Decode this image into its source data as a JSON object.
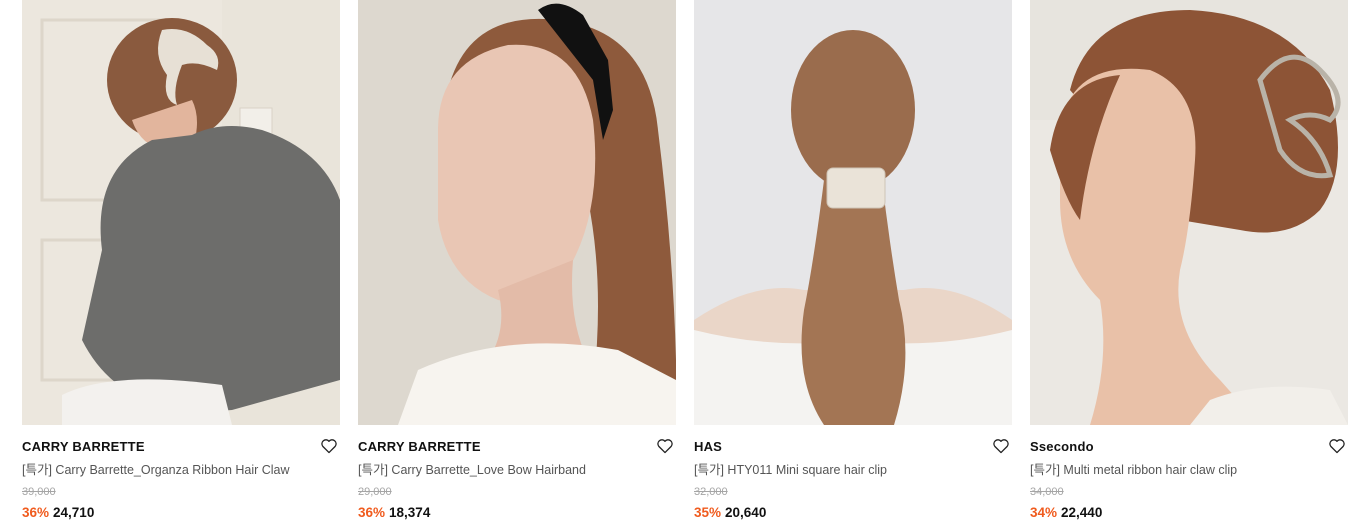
{
  "theme": {
    "discount_color": "#f05b1e",
    "original_price_color": "#a5a5a5"
  },
  "products": [
    {
      "brand": "CARRY BARRETTE",
      "name": "[특가] Carry Barrette_Organza Ribbon Hair Claw",
      "original_price": "39,000",
      "discount_rate": "36%",
      "sale_price": "24,710",
      "wishlist_icon": "heart-outline-icon"
    },
    {
      "brand": "CARRY BARRETTE",
      "name": "[특가] Carry Barrette_Love Bow Hairband",
      "original_price": "29,000",
      "discount_rate": "36%",
      "sale_price": "18,374",
      "wishlist_icon": "heart-outline-icon"
    },
    {
      "brand": "HAS",
      "name": "[특가] HTY011 Mini square hair clip",
      "original_price": "32,000",
      "discount_rate": "35%",
      "sale_price": "20,640",
      "wishlist_icon": "heart-outline-icon"
    },
    {
      "brand": "Ssecondo",
      "name": "[특가] Multi metal ribbon hair claw clip",
      "original_price": "34,000",
      "discount_rate": "34%",
      "sale_price": "22,440",
      "wishlist_icon": "heart-outline-icon"
    }
  ]
}
